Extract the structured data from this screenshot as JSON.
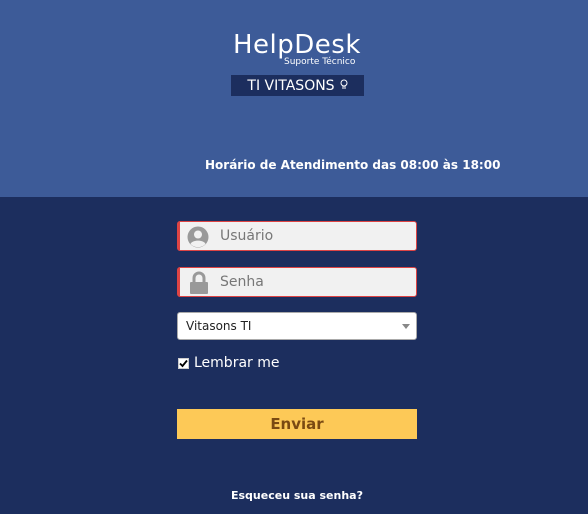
{
  "header": {
    "logo_title": "HelpDesk",
    "logo_subtitle": "Suporte Técnico",
    "brand": "TI VITASONS",
    "brand_icon": "lightbulb-icon",
    "hours": "Horário de Atendimento das 08:00 às 18:00"
  },
  "form": {
    "username_placeholder": "Usuário",
    "password_placeholder": "Senha",
    "company_selected": "Vitasons TI",
    "remember_label": "Lembrar me",
    "remember_checked": true,
    "submit_label": "Enviar",
    "forgot_link": "Esqueceu sua senha?"
  },
  "colors": {
    "top_bg": "#3d5b98",
    "bottom_bg": "#1c2e5e",
    "button": "#fdc957",
    "error_border": "#dd4444"
  }
}
